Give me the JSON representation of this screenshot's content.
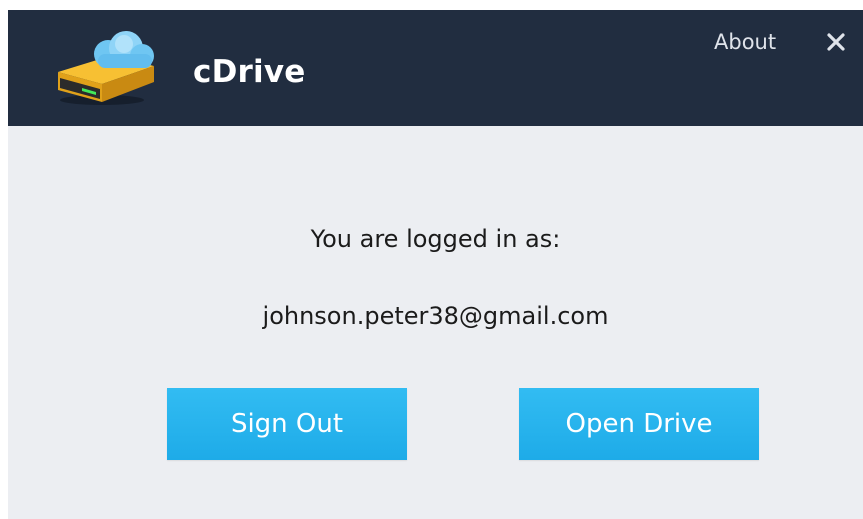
{
  "window": {
    "app_name": "cDrive",
    "about_label": "About",
    "close_glyph": "✕"
  },
  "main": {
    "logged_in_label": "You are logged in as:",
    "email": "johnson.peter38@gmail.com",
    "sign_out_label": "Sign Out",
    "open_drive_label": "Open Drive"
  },
  "icons": {
    "logo": "cloud-drive-icon",
    "close": "close-icon"
  },
  "colors": {
    "titlebar": "#212d40",
    "body": "#eceef2",
    "button": "#22b0ec",
    "text": "#1b1b1b"
  }
}
